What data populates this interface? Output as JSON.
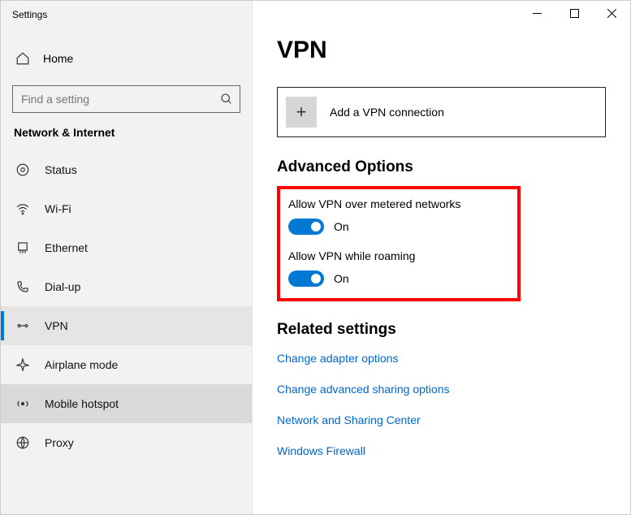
{
  "window": {
    "title": "Settings"
  },
  "sidebar": {
    "home_label": "Home",
    "search_placeholder": "Find a setting",
    "category": "Network & Internet",
    "items": [
      {
        "label": "Status",
        "icon": "status"
      },
      {
        "label": "Wi-Fi",
        "icon": "wifi"
      },
      {
        "label": "Ethernet",
        "icon": "ethernet"
      },
      {
        "label": "Dial-up",
        "icon": "dialup"
      },
      {
        "label": "VPN",
        "icon": "vpn"
      },
      {
        "label": "Airplane mode",
        "icon": "airplane"
      },
      {
        "label": "Mobile hotspot",
        "icon": "hotspot"
      },
      {
        "label": "Proxy",
        "icon": "proxy"
      }
    ]
  },
  "page": {
    "heading": "VPN",
    "add_button": "Add a VPN connection",
    "advanced_heading": "Advanced Options",
    "opt1_label": "Allow VPN over metered networks",
    "opt1_state": "On",
    "opt2_label": "Allow VPN while roaming",
    "opt2_state": "On",
    "related_heading": "Related settings",
    "links": [
      "Change adapter options",
      "Change advanced sharing options",
      "Network and Sharing Center",
      "Windows Firewall"
    ]
  }
}
